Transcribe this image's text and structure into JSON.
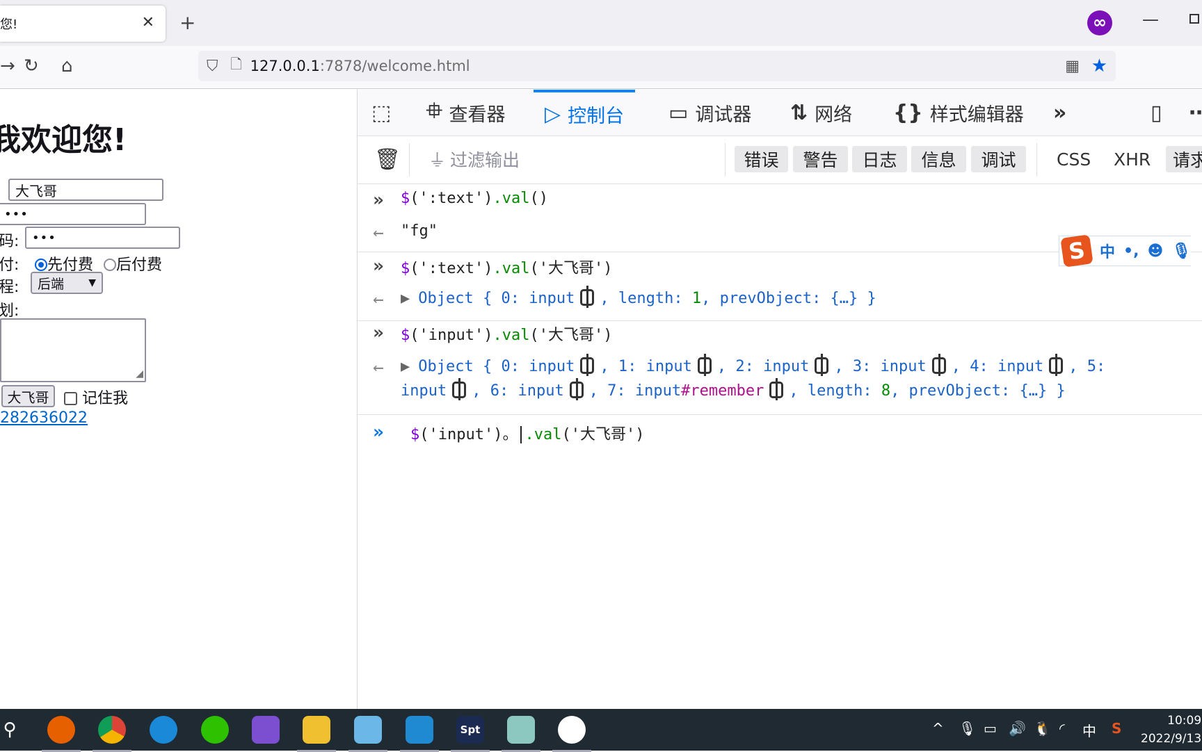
{
  "browser": {
    "tab_title": "您!",
    "tab_close": "✕",
    "new_tab": "+",
    "url_host": "127.0.0.1",
    "url_path": ":7878/welcome.html",
    "accent": "#0a84ff"
  },
  "page": {
    "heading": "我欢迎您!",
    "username_value": "大飞哥",
    "password_value": "•••",
    "confirm_label": "码:",
    "confirm_value": "•••",
    "pay_label": "付:",
    "pay_options": [
      "先付费",
      "后付费"
    ],
    "pay_selected": 0,
    "course_label": "程:",
    "course_value": "后端",
    "plan_label": "划:",
    "button_label": "大飞哥",
    "remember_label": "记住我",
    "link_text": "282636022"
  },
  "devtools": {
    "tabs": [
      {
        "label": "查看器",
        "icon": "inspector-icon"
      },
      {
        "label": "控制台",
        "icon": "console-icon",
        "active": true
      },
      {
        "label": "调试器",
        "icon": "debugger-icon"
      },
      {
        "label": "网络",
        "icon": "network-icon"
      },
      {
        "label": "样式编辑器",
        "icon": "style-editor-icon"
      }
    ],
    "filter_placeholder": "过滤输出",
    "filter_buttons": [
      "错误",
      "警告",
      "日志",
      "信息",
      "调试"
    ],
    "filter_text_buttons": [
      "CSS",
      "XHR"
    ],
    "requests_button": "请求"
  },
  "console": {
    "entries": [
      {
        "kind": "input",
        "segments": [
          [
            "$",
            "dollar"
          ],
          [
            "(':text')",
            "punc"
          ],
          [
            ".val",
            "fn"
          ],
          [
            "()",
            "punc"
          ]
        ]
      },
      {
        "kind": "output",
        "segments": [
          [
            "\"fg\"",
            "ret"
          ]
        ]
      },
      {
        "kind": "input",
        "segments": [
          [
            "$",
            "dollar"
          ],
          [
            "(':text')",
            "punc"
          ],
          [
            ".val",
            "fn"
          ],
          [
            "('大飞哥')",
            "punc"
          ]
        ]
      },
      {
        "kind": "output",
        "expandable": true,
        "segments": [
          [
            "Object { 0: input",
            "prop"
          ],
          [
            "",
            "node"
          ],
          [
            ", length: ",
            "prop"
          ],
          [
            "1",
            "num"
          ],
          [
            ", prevObject: {…} }",
            "prop"
          ]
        ]
      },
      {
        "kind": "input",
        "segments": [
          [
            "$",
            "dollar"
          ],
          [
            "('input')",
            "punc"
          ],
          [
            ".val",
            "fn"
          ],
          [
            "('大飞哥')",
            "punc"
          ]
        ]
      },
      {
        "kind": "output",
        "expandable": true,
        "segments": [
          [
            "Object { 0: input",
            "prop"
          ],
          [
            "",
            "node"
          ],
          [
            ", 1: input",
            "prop"
          ],
          [
            "",
            "node"
          ],
          [
            ", 2: input",
            "prop"
          ],
          [
            "",
            "node"
          ],
          [
            ", 3: input",
            "prop"
          ],
          [
            "",
            "node"
          ],
          [
            ", 4: input",
            "prop"
          ],
          [
            "",
            "node"
          ],
          [
            ", 5:",
            "prop"
          ]
        ]
      },
      {
        "kind": "continuation",
        "segments": [
          [
            "input",
            "prop"
          ],
          [
            "",
            "node"
          ],
          [
            ", 6: input",
            "prop"
          ],
          [
            "",
            "node"
          ],
          [
            ", 7: input",
            "prop"
          ],
          [
            "#remember",
            "id"
          ],
          [
            "",
            "node"
          ],
          [
            ", length: ",
            "prop"
          ],
          [
            "8",
            "num"
          ],
          [
            ", prevObject: {…} }",
            "prop"
          ]
        ]
      }
    ],
    "current_input": {
      "segments": [
        [
          "$",
          "dollar"
        ],
        [
          "('input')。",
          "punc"
        ],
        [
          "|",
          "punc"
        ],
        [
          ".val",
          "fn"
        ],
        [
          "('大飞哥')",
          "punc"
        ]
      ]
    }
  },
  "ime": {
    "mode": "中",
    "items": [
      "•,",
      "☻",
      "🎙"
    ]
  },
  "taskbar": {
    "apps": [
      "search",
      "firefox",
      "chrome",
      "edge",
      "wechat",
      "visual-studio",
      "file-explorer",
      "app",
      "vscode",
      "spt",
      "notes",
      "app2"
    ],
    "spt_label": "Spt",
    "tray": {
      "ime": "中"
    },
    "time": "10:09",
    "date": "2022/9/13"
  }
}
